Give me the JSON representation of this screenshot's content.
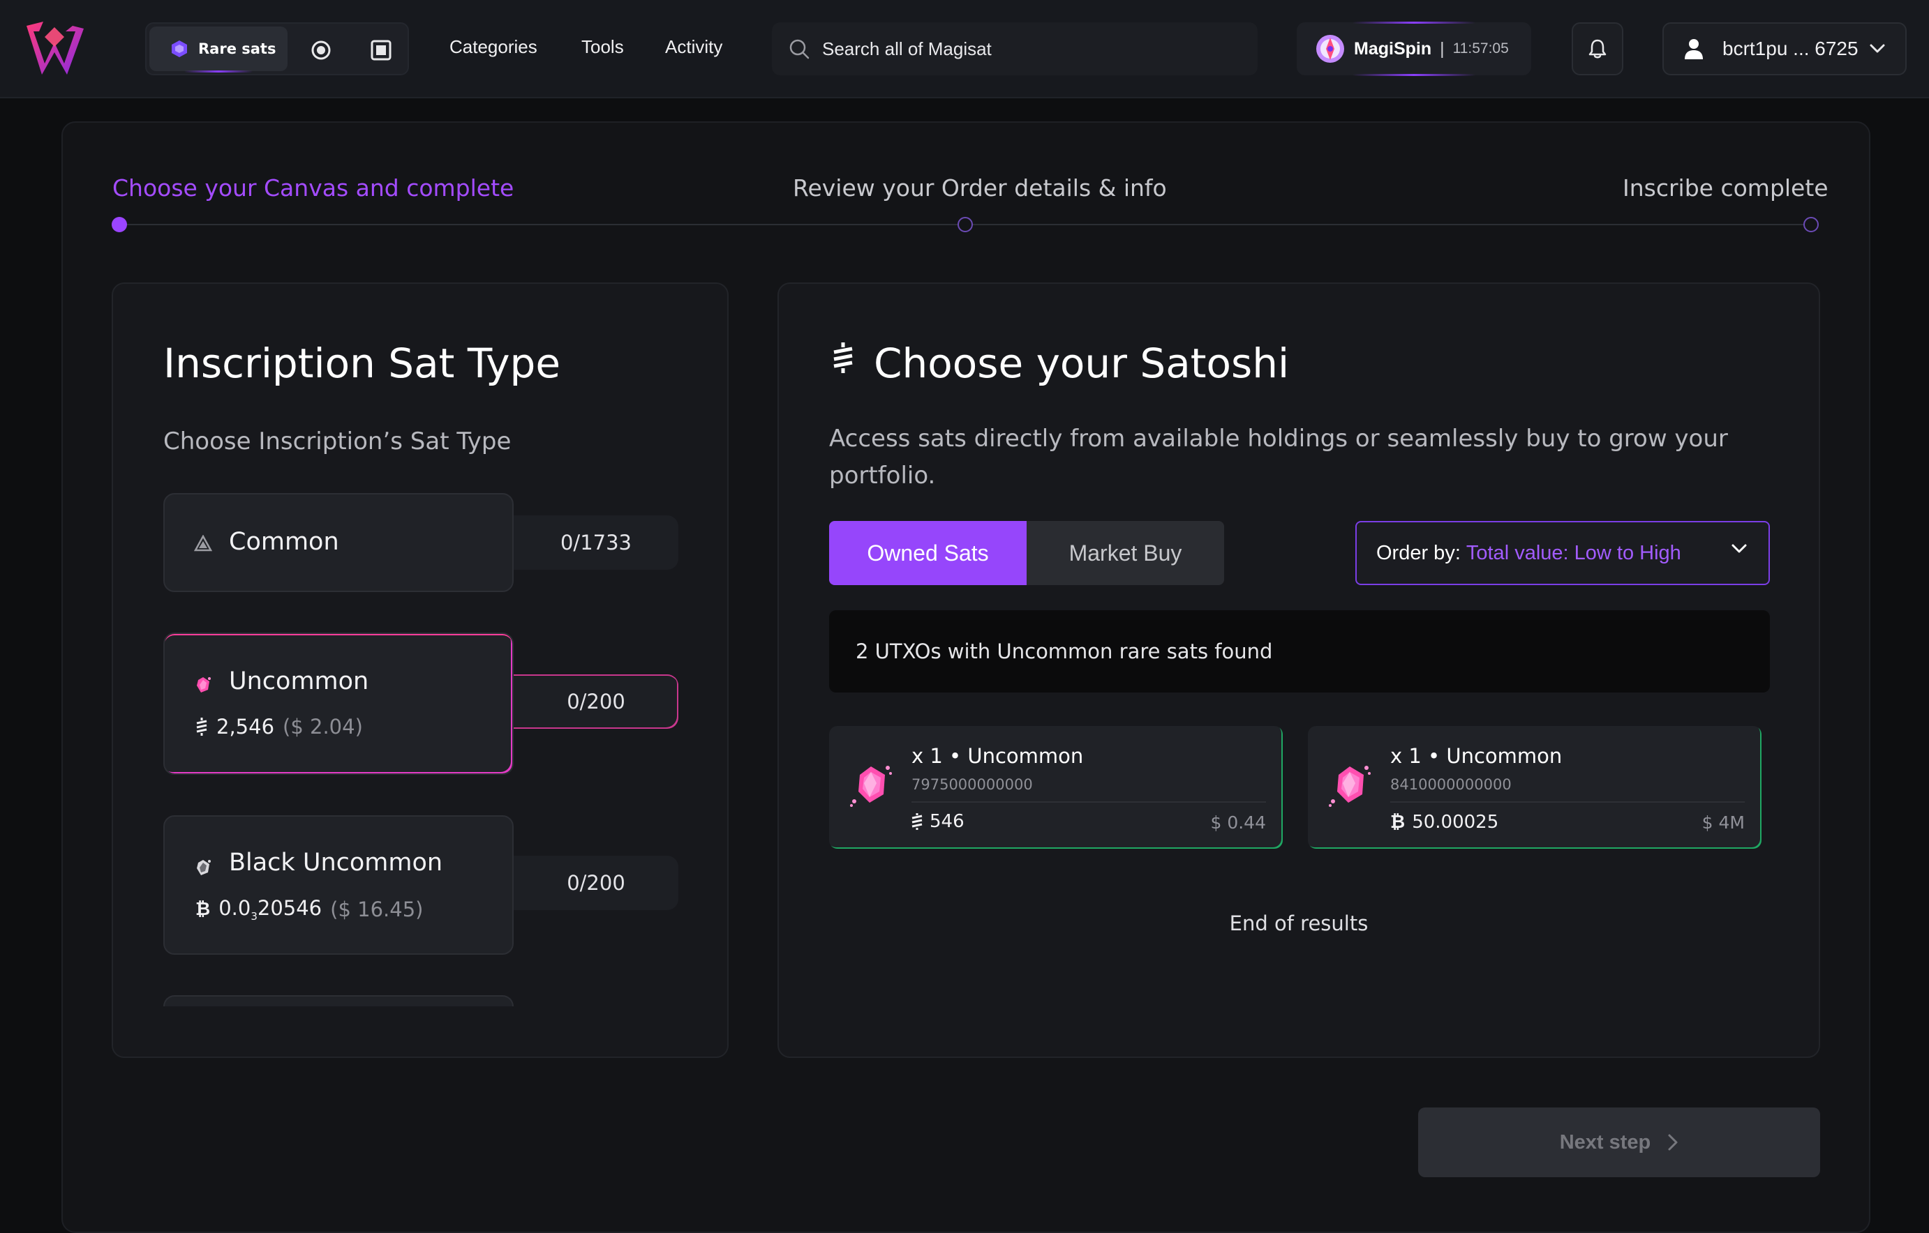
{
  "header": {
    "rare_sats_label": "Rare sats",
    "nav": [
      "Categories",
      "Tools",
      "Activity"
    ],
    "search_placeholder": "Search all of Magisat",
    "magispin_label": "MagiSpin",
    "magispin_separator": "|",
    "magispin_timer": "11:57:05",
    "account_label": "bcrt1pu ... 6725"
  },
  "stepper": {
    "steps": [
      "Choose your Canvas and complete",
      "Review your Order details & info",
      "Inscribe complete"
    ],
    "active_index": 0
  },
  "left": {
    "title": "Inscription Sat Type",
    "subtitle": "Choose Inscription’s Sat Type",
    "types": [
      {
        "name": "Common",
        "count": "0/1733"
      },
      {
        "name": "Uncommon",
        "count": "0/200",
        "price_prefix": "2,546",
        "price_usd": "($ 2.04)"
      },
      {
        "name": "Black Uncommon",
        "count": "0/200",
        "price_main": "0.0",
        "price_sub": "3",
        "price_rest": "20546",
        "price_usd": "($ 16.45)"
      }
    ],
    "selected_type": "Uncommon"
  },
  "right": {
    "title": "Choose your Satoshi",
    "description": "Access sats directly from available holdings or seamlessly buy to grow your portfolio.",
    "tabs": [
      "Owned Sats",
      "Market Buy"
    ],
    "active_tab": "Owned Sats",
    "order_by_label": "Order by:",
    "order_by_value": "Total value: Low to High",
    "found_text": "2 UTXOs with Uncommon rare sats found",
    "utxos": [
      {
        "title": "x 1 • Uncommon",
        "id": "7975000000000",
        "amount": "546",
        "usd": "$ 0.44",
        "unit": "sats"
      },
      {
        "title": "x 1 • Uncommon",
        "id": "8410000000000",
        "amount": "50.00025",
        "usd": "$ 4M",
        "unit": "btc"
      }
    ],
    "end_text": "End of results"
  },
  "footer": {
    "next_label": "Next step"
  },
  "colors": {
    "accent": "#9646fb",
    "uncommon": "#ff4fb0",
    "success_edge": "#1fa863"
  }
}
